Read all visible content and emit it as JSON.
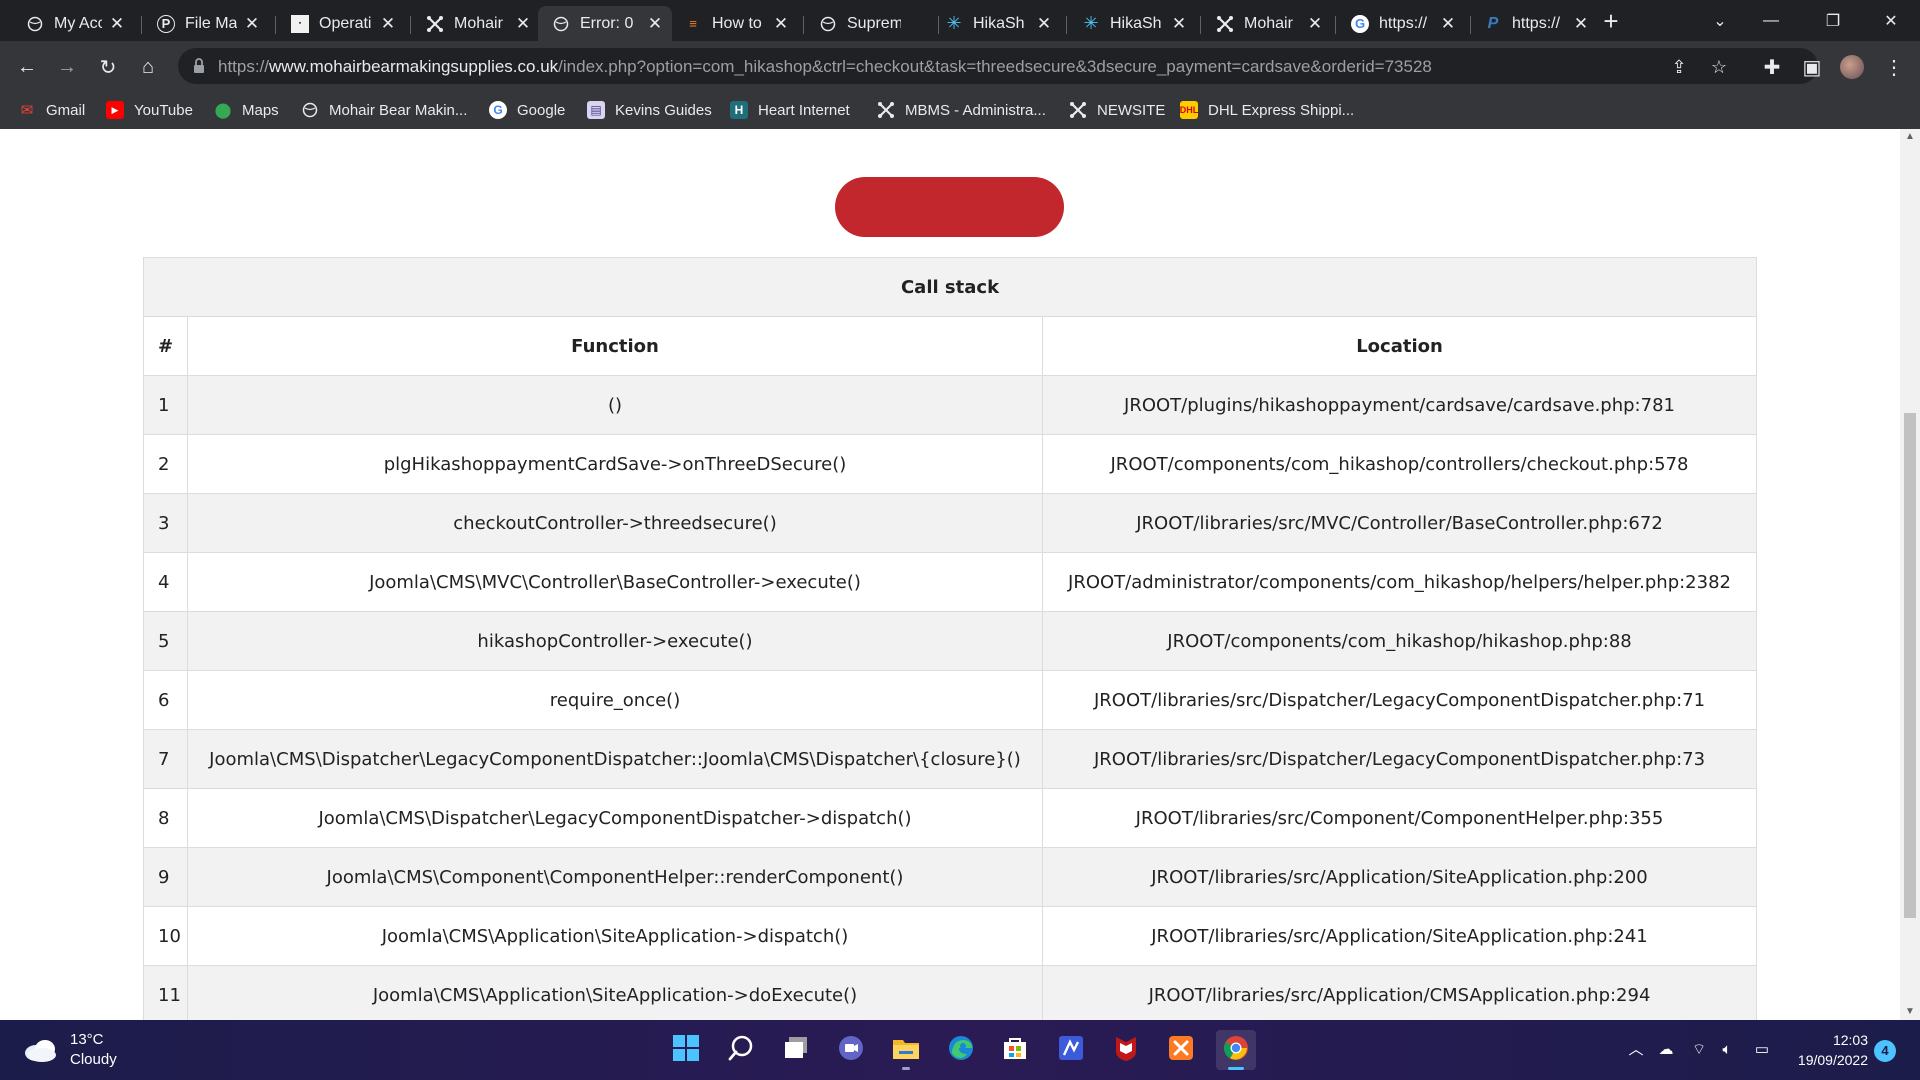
{
  "browser": {
    "tabs": [
      {
        "title": "My Acc",
        "icon": "globe-icon",
        "active": false
      },
      {
        "title": "File Ma",
        "icon": "p-letter-icon",
        "active": false
      },
      {
        "title": "Operati",
        "icon": "plesk-icon",
        "active": false
      },
      {
        "title": "Mohair",
        "icon": "joomla-icon",
        "active": false
      },
      {
        "title": "Error: 0",
        "icon": "globe-icon",
        "active": true
      },
      {
        "title": "How to",
        "icon": "stackoverflow-icon",
        "active": false
      },
      {
        "title": "Suprem",
        "icon": "globe-icon",
        "active": false
      },
      {
        "title": "HikaSh",
        "icon": "hikashop-icon",
        "active": false
      },
      {
        "title": "HikaSh",
        "icon": "hikashop-icon",
        "active": false
      },
      {
        "title": "Mohair",
        "icon": "joomla-icon",
        "active": false
      },
      {
        "title": "https://",
        "icon": "google-icon",
        "active": false
      },
      {
        "title": "https://",
        "icon": "paypal-icon",
        "active": false
      }
    ],
    "url": {
      "scheme": "https://",
      "host": "www.mohairbearmakingsupplies.co.uk",
      "path": "/index.php?option=com_hikashop&ctrl=checkout&task=threedsecure&3dsecure_payment=cardsave&orderid=73528"
    },
    "bookmarks": [
      {
        "label": "Gmail",
        "icon": "gmail-icon"
      },
      {
        "label": "YouTube",
        "icon": "youtube-icon"
      },
      {
        "label": "Maps",
        "icon": "maps-icon"
      },
      {
        "label": "Mohair Bear Makin...",
        "icon": "globe-icon"
      },
      {
        "label": "Google",
        "icon": "google-icon"
      },
      {
        "label": "Kevins Guides",
        "icon": "bookmark-page-icon"
      },
      {
        "label": "Heart Internet",
        "icon": "heart-internet-icon"
      },
      {
        "label": "MBMS - Administra...",
        "icon": "joomla-icon"
      },
      {
        "label": "NEWSITE",
        "icon": "joomla-icon"
      },
      {
        "label": "DHL Express Shippi...",
        "icon": "dhl-icon"
      }
    ]
  },
  "page": {
    "button_color": "#c1272d",
    "callstack": {
      "caption": "Call stack",
      "headers": {
        "num": "#",
        "function": "Function",
        "location": "Location"
      },
      "rows": [
        {
          "num": "1",
          "function": "()",
          "location": "JROOT/plugins/hikashoppayment/cardsave/cardsave.php:781"
        },
        {
          "num": "2",
          "function": "plgHikashoppaymentCardSave->onThreeDSecure()",
          "location": "JROOT/components/com_hikashop/controllers/checkout.php:578"
        },
        {
          "num": "3",
          "function": "checkoutController->threedsecure()",
          "location": "JROOT/libraries/src/MVC/Controller/BaseController.php:672"
        },
        {
          "num": "4",
          "function": "Joomla\\CMS\\MVC\\Controller\\BaseController->execute()",
          "location": "JROOT/administrator/components/com_hikashop/helpers/helper.php:2382"
        },
        {
          "num": "5",
          "function": "hikashopController->execute()",
          "location": "JROOT/components/com_hikashop/hikashop.php:88"
        },
        {
          "num": "6",
          "function": "require_once()",
          "location": "JROOT/libraries/src/Dispatcher/LegacyComponentDispatcher.php:71"
        },
        {
          "num": "7",
          "function": "Joomla\\CMS\\Dispatcher\\LegacyComponentDispatcher::Joomla\\CMS\\Dispatcher\\{closure}()",
          "location": "JROOT/libraries/src/Dispatcher/LegacyComponentDispatcher.php:73"
        },
        {
          "num": "8",
          "function": "Joomla\\CMS\\Dispatcher\\LegacyComponentDispatcher->dispatch()",
          "location": "JROOT/libraries/src/Component/ComponentHelper.php:355"
        },
        {
          "num": "9",
          "function": "Joomla\\CMS\\Component\\ComponentHelper::renderComponent()",
          "location": "JROOT/libraries/src/Application/SiteApplication.php:200"
        },
        {
          "num": "10",
          "function": "Joomla\\CMS\\Application\\SiteApplication->dispatch()",
          "location": "JROOT/libraries/src/Application/SiteApplication.php:241"
        },
        {
          "num": "11",
          "function": "Joomla\\CMS\\Application\\SiteApplication->doExecute()",
          "location": "JROOT/libraries/src/Application/CMSApplication.php:294"
        }
      ]
    }
  },
  "taskbar": {
    "weather": {
      "temp": "13°C",
      "condition": "Cloudy"
    },
    "apps": [
      {
        "name": "start-icon"
      },
      {
        "name": "search-icon"
      },
      {
        "name": "task-view-icon"
      },
      {
        "name": "teams-chat-icon"
      },
      {
        "name": "file-explorer-icon"
      },
      {
        "name": "edge-icon"
      },
      {
        "name": "store-icon"
      },
      {
        "name": "app-icon"
      },
      {
        "name": "mcafee-icon"
      },
      {
        "name": "xampp-icon"
      },
      {
        "name": "chrome-icon"
      }
    ],
    "clock": {
      "time": "12:03",
      "date": "19/09/2022"
    },
    "notifications": "4"
  }
}
